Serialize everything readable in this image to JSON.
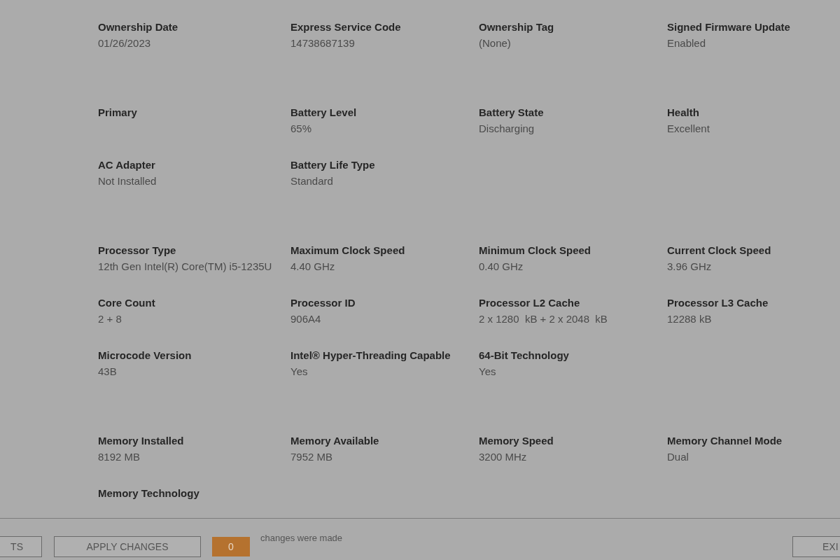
{
  "sections": [
    {
      "rows": [
        [
          {
            "label": "Ownership Date",
            "value": "01/26/2023"
          },
          {
            "label": "Express Service Code",
            "value": "14738687139"
          },
          {
            "label": "Ownership Tag",
            "value": "(None)"
          },
          {
            "label": "Signed Firmware Update",
            "value": "Enabled"
          }
        ]
      ]
    },
    {
      "rows": [
        [
          {
            "label": "Primary"
          },
          {
            "label": "Battery Level",
            "value": "65%"
          },
          {
            "label": "Battery State",
            "value": "Discharging"
          },
          {
            "label": "Health",
            "value": "Excellent"
          }
        ],
        [
          {
            "label": "AC Adapter",
            "value": "Not Installed"
          },
          {
            "label": "Battery Life Type",
            "value": "Standard"
          }
        ]
      ]
    },
    {
      "rows": [
        [
          {
            "label": "Processor Type",
            "value": "12th Gen Intel(R) Core(TM) i5-1235U"
          },
          {
            "label": "Maximum Clock Speed",
            "value": "4.40 GHz"
          },
          {
            "label": "Minimum Clock Speed",
            "value": "0.40 GHz"
          },
          {
            "label": "Current Clock Speed",
            "value": "3.96 GHz"
          }
        ],
        [
          {
            "label": "Core Count",
            "value": "2 + 8"
          },
          {
            "label": "Processor ID",
            "value": "906A4"
          },
          {
            "label": "Processor L2 Cache",
            "value": "2 x 1280  kB + 2 x 2048  kB"
          },
          {
            "label": "Processor L3 Cache",
            "value": "12288 kB"
          }
        ],
        [
          {
            "label": "Microcode Version",
            "value": "43B"
          },
          {
            "label": "Intel® Hyper-Threading Capable",
            "value": "Yes"
          },
          {
            "label": "64-Bit Technology",
            "value": "Yes"
          }
        ]
      ]
    },
    {
      "rows": [
        [
          {
            "label": "Memory Installed",
            "value": "8192 MB"
          },
          {
            "label": "Memory Available",
            "value": "7952 MB"
          },
          {
            "label": "Memory Speed",
            "value": "3200 MHz"
          },
          {
            "label": "Memory Channel Mode",
            "value": "Dual"
          }
        ],
        [
          {
            "label": "Memory Technology"
          }
        ]
      ]
    }
  ],
  "footer": {
    "left_button": "TS",
    "apply_button": "APPLY CHANGES",
    "change_count": "0",
    "change_text": "changes were made",
    "right_button": "EXI"
  }
}
